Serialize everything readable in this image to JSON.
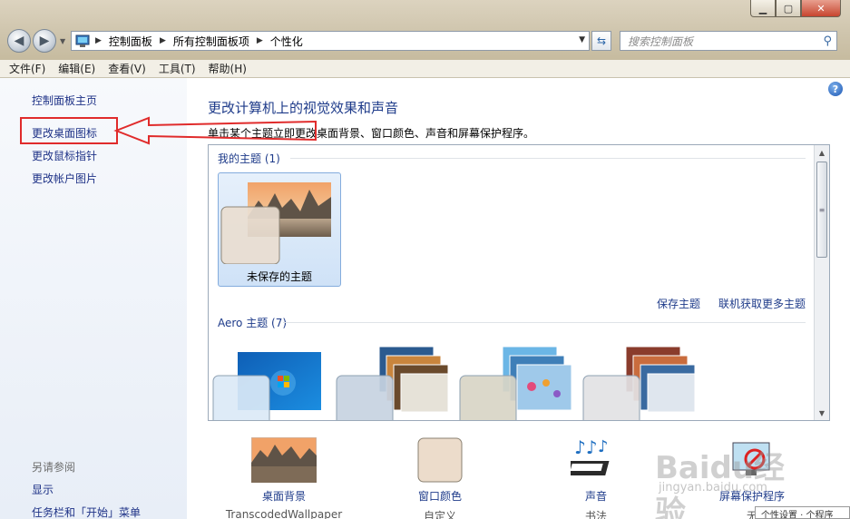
{
  "window": {
    "btn_min": "▁",
    "btn_max": "▢",
    "btn_close": "✕"
  },
  "nav": {
    "breadcrumb": [
      "控制面板",
      "所有控制面板项",
      "个性化"
    ],
    "search_placeholder": "搜索控制面板"
  },
  "menu": [
    "文件(F)",
    "编辑(E)",
    "查看(V)",
    "工具(T)",
    "帮助(H)"
  ],
  "sidebar": {
    "items": [
      "控制面板主页",
      "更改桌面图标",
      "更改鼠标指针",
      "更改帐户图片"
    ],
    "see_also_title": "另请参阅",
    "see_also": [
      "显示",
      "任务栏和「开始」菜单"
    ]
  },
  "main": {
    "title": "更改计算机上的视觉效果和声音",
    "subtitle": "单击某个主题立即更改桌面背景、窗口颜色、声音和屏幕保护程序。",
    "my_themes_label": "我的主题 (1)",
    "unsaved_theme": "未保存的主题",
    "save_theme": "保存主题",
    "get_more_themes": "联机获取更多主题",
    "aero_label": "Aero 主题 (7)",
    "help": "?"
  },
  "bottom": [
    {
      "label": "桌面背景",
      "sub": "TranscodedWallpaper"
    },
    {
      "label": "窗口颜色",
      "sub": "自定义"
    },
    {
      "label": "声音",
      "sub": "书法"
    },
    {
      "label": "屏幕保护程序",
      "sub": "无"
    }
  ],
  "watermark": {
    "brand": "Baidu经验",
    "url": "jingyan.baidu.com"
  },
  "popup": "个性设置 · 个程序",
  "colors": {
    "accent": "#1e3b8a",
    "highlight": "#e02b2b"
  }
}
